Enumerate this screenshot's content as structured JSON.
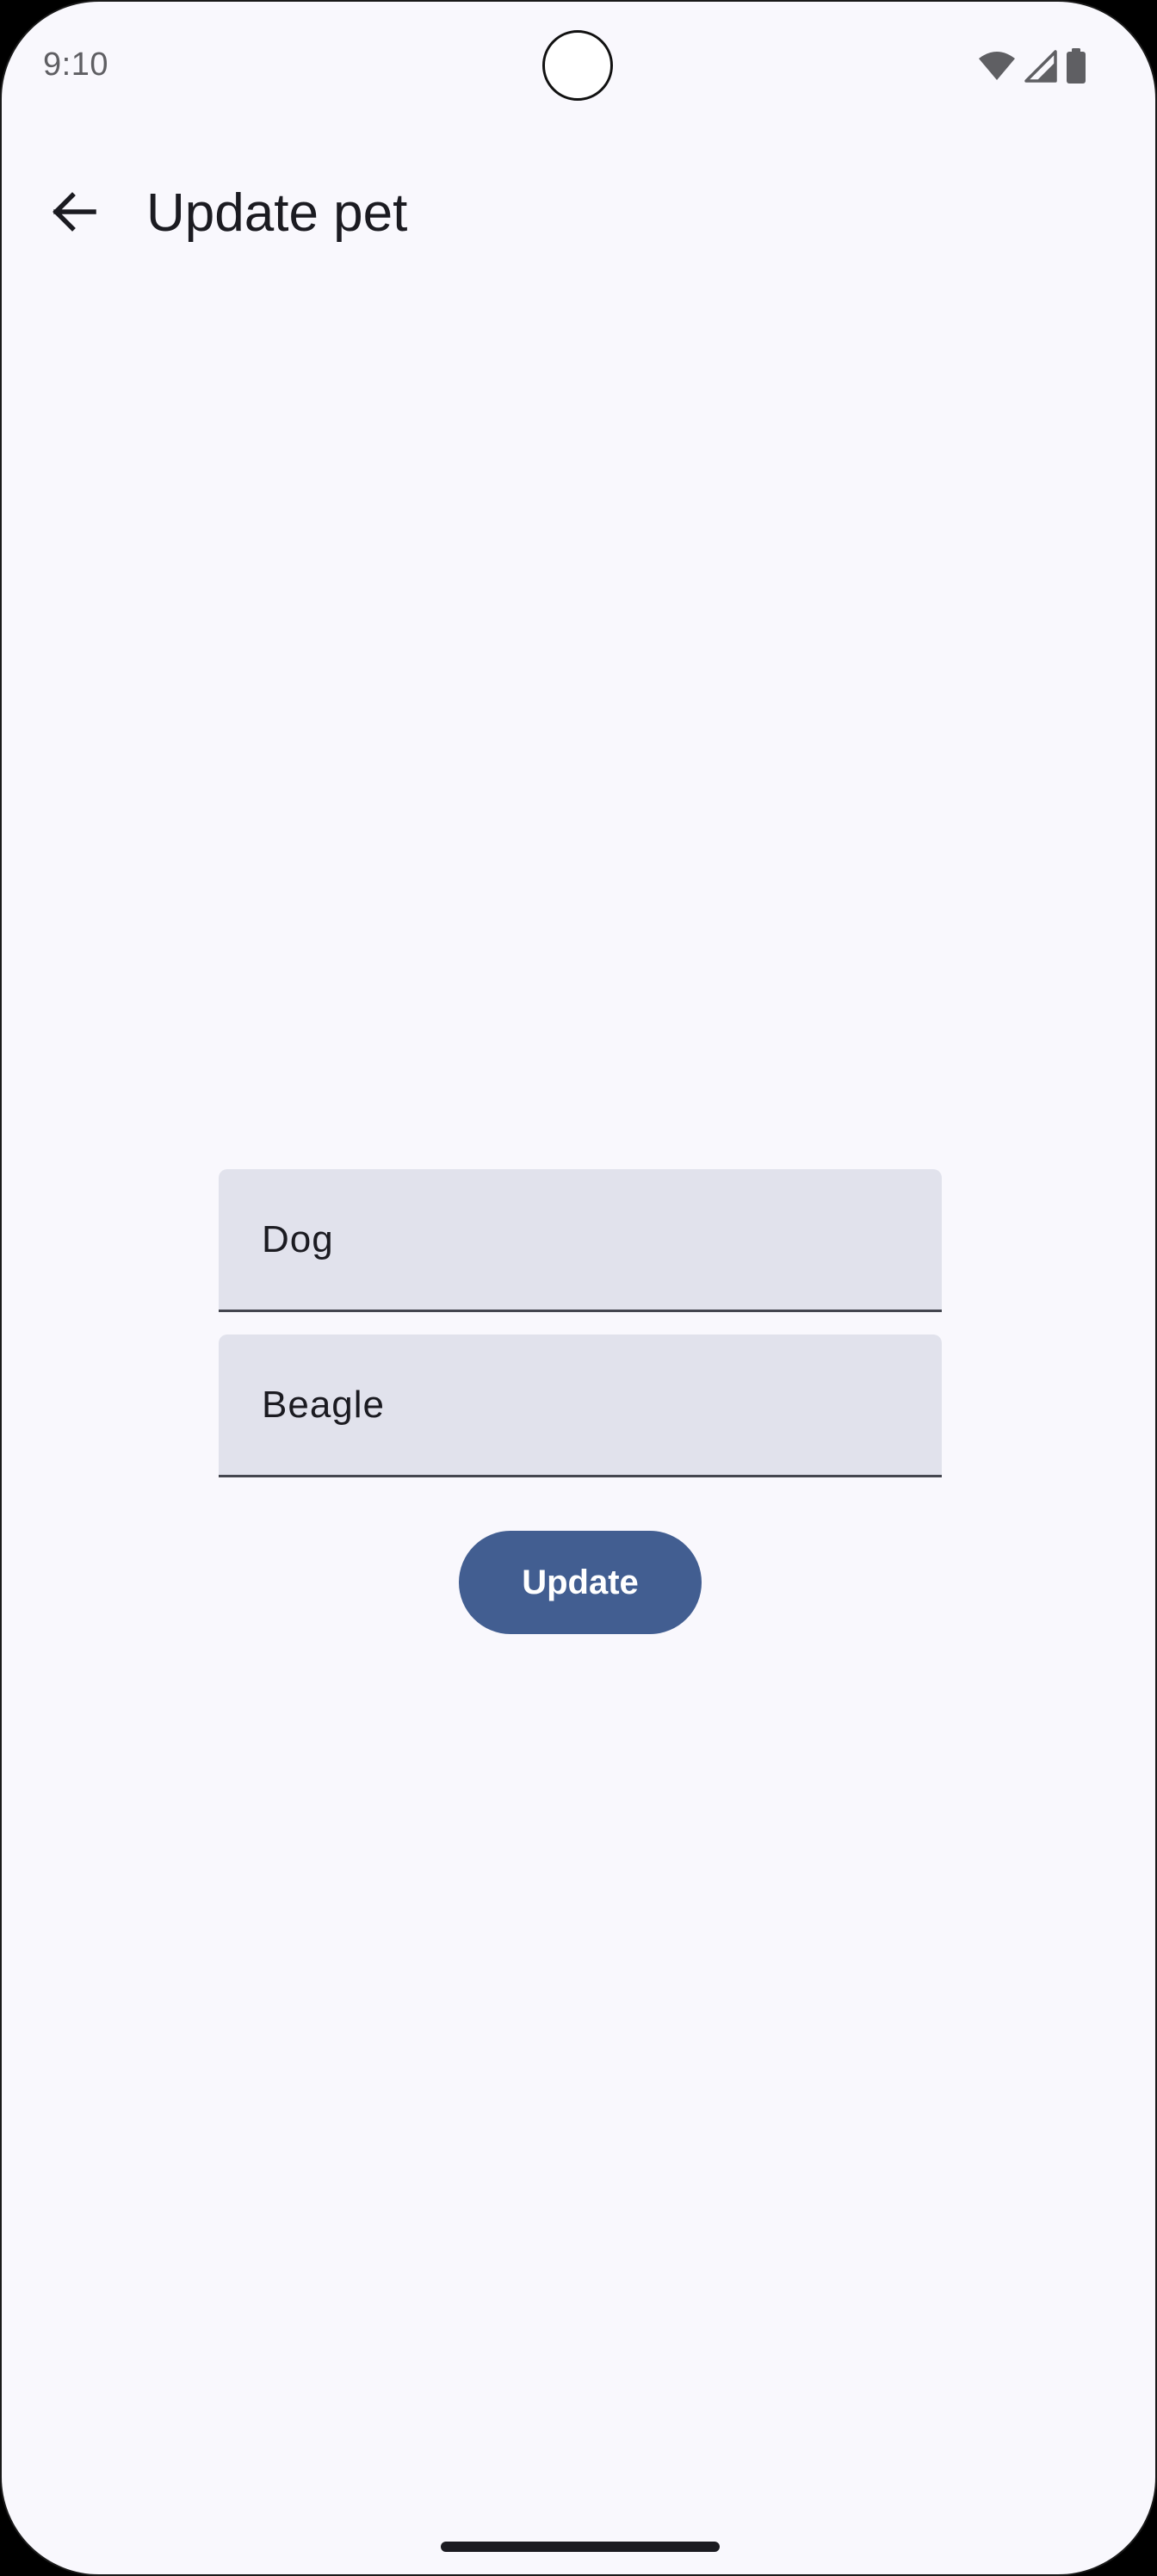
{
  "status_bar": {
    "time": "9:10",
    "icons": [
      "wifi-icon",
      "cellular-signal-icon",
      "battery-icon"
    ]
  },
  "app_bar": {
    "back_icon": "arrow-back-icon",
    "title": "Update pet"
  },
  "form": {
    "type_field": {
      "value": "Dog"
    },
    "breed_field": {
      "value": "Beagle"
    },
    "submit_label": "Update"
  },
  "colors": {
    "background": "#f9f8fd",
    "field_fill": "#e1e2ec",
    "primary_button": "#425e91",
    "on_primary": "#ffffff",
    "on_surface": "#1b1b21"
  }
}
